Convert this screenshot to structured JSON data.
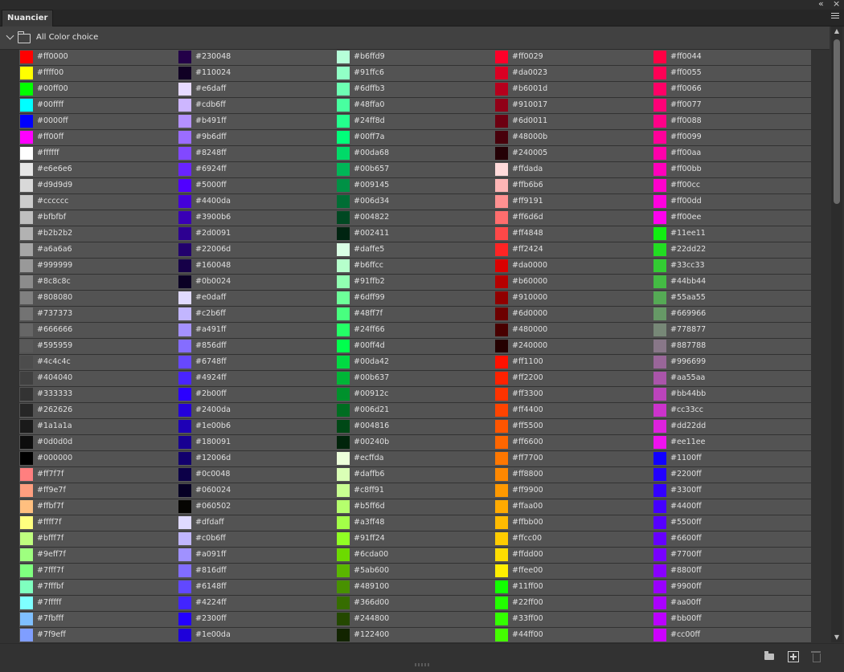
{
  "panel": {
    "tab_label": "Nuancier",
    "collapse_glyph": "«",
    "close_glyph": "×"
  },
  "group": {
    "title": "All Color choice"
  },
  "icons": {
    "folder": "folder-icon",
    "chevron": "chevron-down-icon",
    "menu": "panel-menu-icon",
    "new_group": "new-group-icon",
    "new_swatch": "new-swatch-icon",
    "delete": "trash-icon"
  },
  "scroll": {
    "up": "▲",
    "down": "▼"
  },
  "columns": [
    [
      "#ff0000",
      "#ffff00",
      "#00ff00",
      "#00ffff",
      "#0000ff",
      "#ff00ff",
      "#ffffff",
      "#e6e6e6",
      "#d9d9d9",
      "#cccccc",
      "#bfbfbf",
      "#b2b2b2",
      "#a6a6a6",
      "#999999",
      "#8c8c8c",
      "#808080",
      "#737373",
      "#666666",
      "#595959",
      "#4c4c4c",
      "#404040",
      "#333333",
      "#262626",
      "#1a1a1a",
      "#0d0d0d",
      "#000000",
      "#ff7f7f",
      "#ff9e7f",
      "#ffbf7f",
      "#ffff7f",
      "#bfff7f",
      "#9eff7f",
      "#7fff7f",
      "#7fffbf",
      "#7fffff",
      "#7fbfff",
      "#7f9eff"
    ],
    [
      "#230048",
      "#110024",
      "#e6daff",
      "#cdb6ff",
      "#b491ff",
      "#9b6dff",
      "#8248ff",
      "#6924ff",
      "#5000ff",
      "#4400da",
      "#3900b6",
      "#2d0091",
      "#22006d",
      "#160048",
      "#0b0024",
      "#e0daff",
      "#c2b6ff",
      "#a491ff",
      "#856dff",
      "#6748ff",
      "#4924ff",
      "#2b00ff",
      "#2400da",
      "#1e00b6",
      "#180091",
      "#12006d",
      "#0c0048",
      "#060024",
      "#060502",
      "#dfdaff",
      "#c0b6ff",
      "#a091ff",
      "#816dff",
      "#6148ff",
      "#4224ff",
      "#2300ff",
      "#1e00da"
    ],
    [
      "#b6ffd9",
      "#91ffc6",
      "#6dffb3",
      "#48ffa0",
      "#24ff8d",
      "#00ff7a",
      "#00da68",
      "#00b657",
      "#009145",
      "#006d34",
      "#004822",
      "#002411",
      "#daffe5",
      "#b6ffcc",
      "#91ffb2",
      "#6dff99",
      "#48ff7f",
      "#24ff66",
      "#00ff4d",
      "#00da42",
      "#00b637",
      "#00912c",
      "#006d21",
      "#004816",
      "#00240b",
      "#ecffda",
      "#daffb6",
      "#c8ff91",
      "#b5ff6d",
      "#a3ff48",
      "#91ff24",
      "#6cda00",
      "#5ab600",
      "#489100",
      "#366d00",
      "#244800",
      "#122400"
    ],
    [
      "#ff0029",
      "#da0023",
      "#b6001d",
      "#910017",
      "#6d0011",
      "#48000b",
      "#240005",
      "#ffdada",
      "#ffb6b6",
      "#ff9191",
      "#ff6d6d",
      "#ff4848",
      "#ff2424",
      "#da0000",
      "#b60000",
      "#910000",
      "#6d0000",
      "#480000",
      "#240000",
      "#ff1100",
      "#ff2200",
      "#ff3300",
      "#ff4400",
      "#ff5500",
      "#ff6600",
      "#ff7700",
      "#ff8800",
      "#ff9900",
      "#ffaa00",
      "#ffbb00",
      "#ffcc00",
      "#ffdd00",
      "#ffee00",
      "#11ff00",
      "#22ff00",
      "#33ff00",
      "#44ff00"
    ],
    [
      "#ff0044",
      "#ff0055",
      "#ff0066",
      "#ff0077",
      "#ff0088",
      "#ff0099",
      "#ff00aa",
      "#ff00bb",
      "#ff00cc",
      "#ff00dd",
      "#ff00ee",
      "#11ee11",
      "#22dd22",
      "#33cc33",
      "#44bb44",
      "#55aa55",
      "#669966",
      "#778877",
      "#887788",
      "#996699",
      "#aa55aa",
      "#bb44bb",
      "#cc33cc",
      "#dd22dd",
      "#ee11ee",
      "#1100ff",
      "#2200ff",
      "#3300ff",
      "#4400ff",
      "#5500ff",
      "#6600ff",
      "#7700ff",
      "#8800ff",
      "#9900ff",
      "#aa00ff",
      "#bb00ff",
      "#cc00ff"
    ]
  ]
}
